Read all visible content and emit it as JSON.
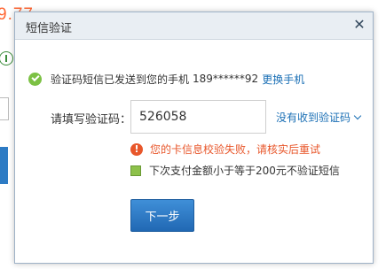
{
  "background": {
    "price_fragment": "9.77"
  },
  "dialog": {
    "title": "短信验证",
    "close_symbol": "✕",
    "sent_message": "验证码短信已发送到您的手机",
    "phone": "189******92",
    "change_phone_link": "更换手机",
    "code_label": "请填写验证码：",
    "code_value": "526058",
    "no_code_link": "没有收到验证码",
    "error_message": "您的卡信息校验失败，请核实后重试",
    "skip_sms_label": "下次支付金额小于等于200元不验证短信",
    "next_button": "下一步"
  },
  "colors": {
    "accent_blue": "#1a6fb5",
    "button_blue": "#2d7bc4",
    "error_orange": "#e8572b",
    "success_green": "#7cc144",
    "checkbox_green": "#8dc14a"
  }
}
